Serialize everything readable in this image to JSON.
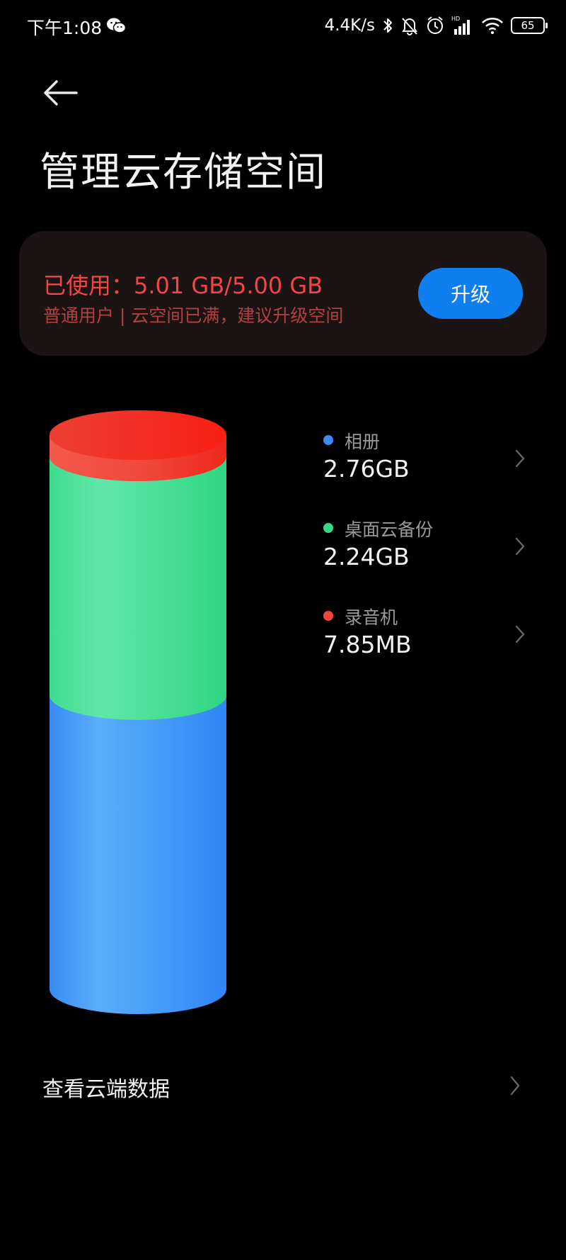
{
  "status_bar": {
    "time": "下午1:08",
    "speed": "4.4K/s",
    "battery": "65",
    "signal_badge": "HD"
  },
  "header": {
    "title": "管理云存储空间"
  },
  "usage_card": {
    "usage_text": "已使用：5.01 GB/5.00 GB",
    "usage_sub": "普通用户 | 云空间已满，建议升级空间",
    "upgrade_label": "升级"
  },
  "storage": {
    "items": [
      {
        "name": "相册",
        "size": "2.76GB",
        "gb": 2.76,
        "color": "#3b8cf5"
      },
      {
        "name": "桌面云备份",
        "size": "2.24GB",
        "gb": 2.24,
        "color": "#36d98a"
      },
      {
        "name": "录音机",
        "size": "7.85MB",
        "gb": 0.00785,
        "color": "#f5453a"
      }
    ]
  },
  "cloud_data": {
    "label": "查看云端数据"
  },
  "colors": {
    "accent": "#0f7ff0",
    "warning": "#f04646",
    "background": "#000000"
  }
}
